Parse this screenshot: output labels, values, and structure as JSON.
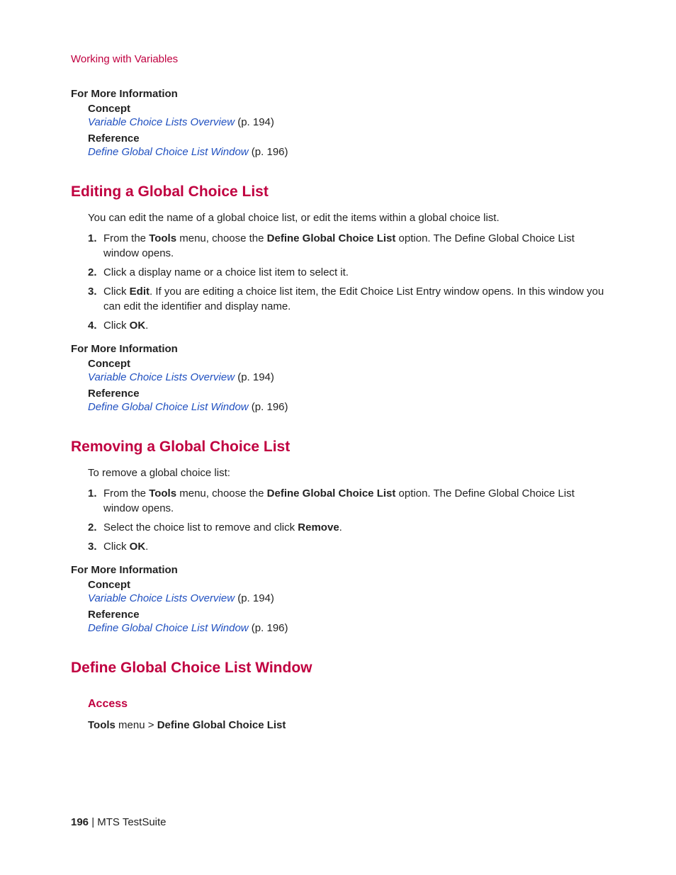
{
  "breadcrumb": "Working with Variables",
  "fmi_label": "For More Information",
  "concept_label": "Concept",
  "reference_label": "Reference",
  "link_vclo": "Variable Choice Lists Overview",
  "link_vclo_pg": "  (p. 194)",
  "link_dgclw": "Define Global Choice List Window",
  "link_dgclw_pg": "  (p. 196)",
  "s1_heading": "Editing a Global Choice List",
  "s1_para": "You can edit the name of a global choice list, or edit the items within a global choice list.",
  "s1_steps": [
    {
      "n": "1.",
      "pre": "From the ",
      "b1": "Tools",
      "mid": " menu, choose the ",
      "b2": "Define Global Choice List",
      "post": " option. The Define Global Choice List window opens."
    },
    {
      "n": "2.",
      "text": "Click a display name or a choice list item to select it."
    },
    {
      "n": "3.",
      "pre": "Click ",
      "b1": "Edit",
      "post": ". If you are editing a choice list item, the Edit Choice List Entry window opens. In this window you can edit the identifier and display name."
    },
    {
      "n": "4.",
      "pre": "Click ",
      "b1": "OK",
      "post": "."
    }
  ],
  "s2_heading": "Removing a Global Choice List",
  "s2_para": "To remove a global choice list:",
  "s2_steps": [
    {
      "n": "1.",
      "pre": "From the ",
      "b1": "Tools",
      "mid": " menu, choose the ",
      "b2": "Define Global Choice List",
      "post": " option. The Define Global Choice List window opens."
    },
    {
      "n": "2.",
      "pre": "Select the choice list to remove and click ",
      "b1": "Remove",
      "post": "."
    },
    {
      "n": "3.",
      "pre": "Click ",
      "b1": "OK",
      "post": "."
    }
  ],
  "s3_heading": "Define Global Choice List Window",
  "s3_access_heading": "Access",
  "s3_access_b1": "Tools",
  "s3_access_mid": " menu > ",
  "s3_access_b2": "Define Global Choice List",
  "footer_page": "196",
  "footer_sep": " | ",
  "footer_product": "MTS TestSuite"
}
